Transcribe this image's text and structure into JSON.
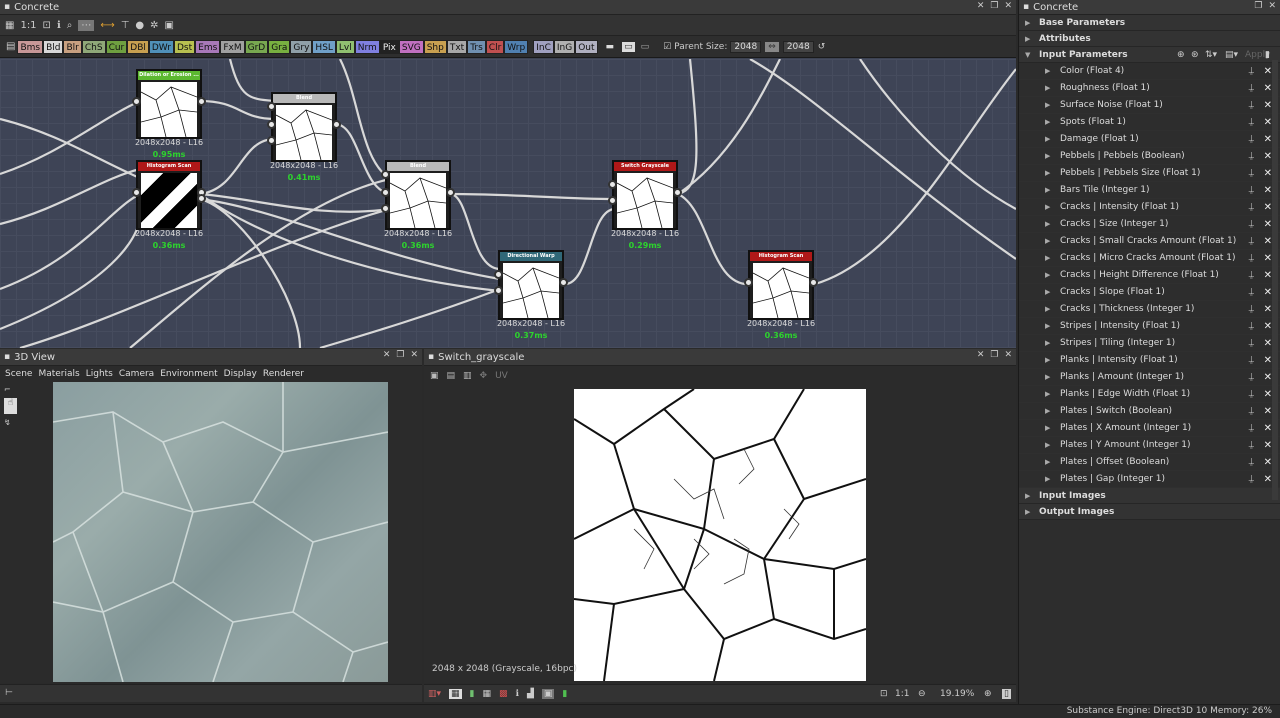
{
  "graph_window": {
    "title": "Concrete"
  },
  "graph_toolbar": {
    "zoom_label": "1:1"
  },
  "filters": [
    {
      "label": "Bms",
      "color": "#c89898"
    },
    {
      "label": "Bld",
      "color": "#d8d8d8"
    },
    {
      "label": "Blr",
      "color": "#c8a080"
    },
    {
      "label": "ChS",
      "color": "#8fa878"
    },
    {
      "label": "Cur",
      "color": "#6fa040"
    },
    {
      "label": "DBl",
      "color": "#c8a050"
    },
    {
      "label": "DWr",
      "color": "#5090b8"
    },
    {
      "label": "Dst",
      "color": "#b8c050"
    },
    {
      "label": "Ems",
      "color": "#a878b8"
    },
    {
      "label": "FxM",
      "color": "#a0a0a0"
    },
    {
      "label": "GrD",
      "color": "#78a850"
    },
    {
      "label": "Gra",
      "color": "#78b040"
    },
    {
      "label": "Gry",
      "color": "#90a0a8"
    },
    {
      "label": "HSL",
      "color": "#70a0c8"
    },
    {
      "label": "Lvl",
      "color": "#90c070"
    },
    {
      "label": "Nrm",
      "color": "#8080e0"
    },
    {
      "label": "Pix",
      "color": "#222222"
    },
    {
      "label": "SVG",
      "color": "#c070c0"
    },
    {
      "label": "Shp",
      "color": "#c8a050"
    },
    {
      "label": "Txt",
      "color": "#a8a8a8"
    },
    {
      "label": "Trs",
      "color": "#7090b0"
    },
    {
      "label": "Clr",
      "color": "#c05050"
    },
    {
      "label": "Wrp",
      "color": "#5080b0"
    },
    {
      "label": "InC",
      "color": "#a0a0c0"
    },
    {
      "label": "InG",
      "color": "#b0b0b0"
    },
    {
      "label": "Out",
      "color": "#b0b0c0"
    }
  ],
  "parent_size": {
    "label": "Parent Size:",
    "value": "2048",
    "value2": "2048"
  },
  "nodes": [
    {
      "title": "Dilation or Erosion ...",
      "color": "#5cb830",
      "res": "2048x2048 - L16",
      "time": "0.95ms"
    },
    {
      "title": "Histogram Scan",
      "color": "#b01818",
      "res": "2048x2048 - L16",
      "time": "0.36ms"
    },
    {
      "title": "Blend",
      "color": "#b8b8b8",
      "res": "2048x2048 - L16",
      "time": "0.41ms"
    },
    {
      "title": "Blend",
      "color": "#b8b8b8",
      "res": "2048x2048 - L16",
      "time": "0.36ms"
    },
    {
      "title": "Directional Warp",
      "color": "#306878",
      "res": "2048x2048 - L16",
      "time": "0.37ms"
    },
    {
      "title": "Switch Grayscale",
      "color": "#b01818",
      "res": "2048x2048 - L16",
      "time": "0.29ms"
    },
    {
      "title": "Histogram Scan",
      "color": "#b01818",
      "res": "2048x2048 - L16",
      "time": "0.36ms"
    }
  ],
  "view3d": {
    "title": "3D View",
    "menu": [
      "Scene",
      "Materials",
      "Lights",
      "Camera",
      "Environment",
      "Display",
      "Renderer"
    ]
  },
  "view2d": {
    "title": "Switch_grayscale",
    "uv": "UV",
    "info": "2048 x 2048 (Grayscale, 16bpc)",
    "zoom_ratio": "1:1",
    "zoom": "19.19%"
  },
  "params_window": {
    "title": "Concrete"
  },
  "sections": {
    "base": "Base Parameters",
    "attributes": "Attributes",
    "inputs": "Input Parameters",
    "apply": "Apply",
    "images": "Input Images",
    "outputs": "Output Images"
  },
  "params": [
    "Color (Float 4)",
    "Roughness (Float 1)",
    "Surface Noise (Float 1)",
    "Spots (Float 1)",
    "Damage (Float 1)",
    "Pebbels | Pebbels (Boolean)",
    "Pebbels | Pebbels Size (Float 1)",
    "Bars Tile (Integer 1)",
    "Cracks | Intensity (Float 1)",
    "Cracks | Size (Integer 1)",
    "Cracks | Small Cracks Amount (Float 1)",
    "Cracks | Micro Cracks Amount (Float 1)",
    "Cracks | Height Difference (Float 1)",
    "Cracks | Slope (Float 1)",
    "Cracks | Thickness (Integer 1)",
    "Stripes | Intensity (Float 1)",
    "Stripes | Tiling (Integer 1)",
    "Planks | Intensity (Float 1)",
    "Planks | Amount (Integer 1)",
    "Planks | Edge Width (Float 1)",
    "Plates | Switch (Boolean)",
    "Plates | X Amount (Integer 1)",
    "Plates | Y Amount (Integer 1)",
    "Plates | Offset (Boolean)",
    "Plates | Gap (Integer 1)"
  ],
  "status": {
    "text": "Substance Engine: Direct3D 10  Memory: 26%"
  }
}
